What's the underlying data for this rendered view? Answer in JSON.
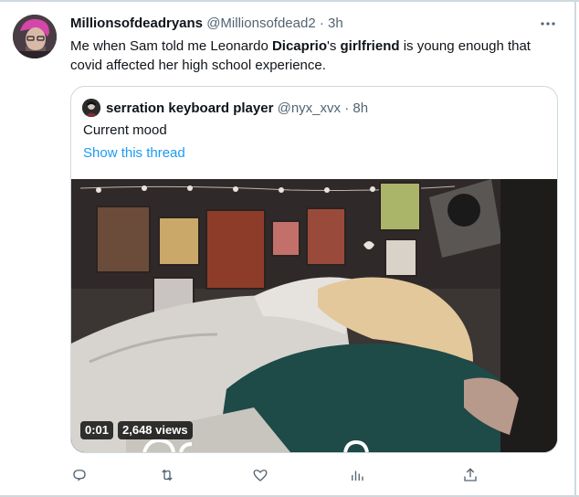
{
  "tweet": {
    "display_name": "Millionsofdeadryans",
    "handle": "@Millionsofdead2",
    "separator": "·",
    "time": "3h",
    "text_1": "Me when Sam told me Leonardo ",
    "text_bold_1": "Dicaprio",
    "text_2": "'s ",
    "text_bold_2": "girlfriend",
    "text_3": " is young enough that covid affected her high school experience."
  },
  "quote": {
    "display_name": "serration keyboard player",
    "handle": "@nyx_xvx",
    "separator": "·",
    "time": "8h",
    "text": "Current mood",
    "show_thread": "Show this thread"
  },
  "video": {
    "timestamp": "0:01",
    "views": "2,648 views"
  },
  "actions": {
    "retweet_count": "",
    "like_count": "",
    "views_count": "",
    "icons": [
      "reply-icon",
      "retweet-icon",
      "like-icon",
      "views-icon",
      "share-icon"
    ]
  },
  "colors": {
    "link": "#1d9bf0",
    "secondary_text": "#536471",
    "border": "#cfd9de"
  }
}
